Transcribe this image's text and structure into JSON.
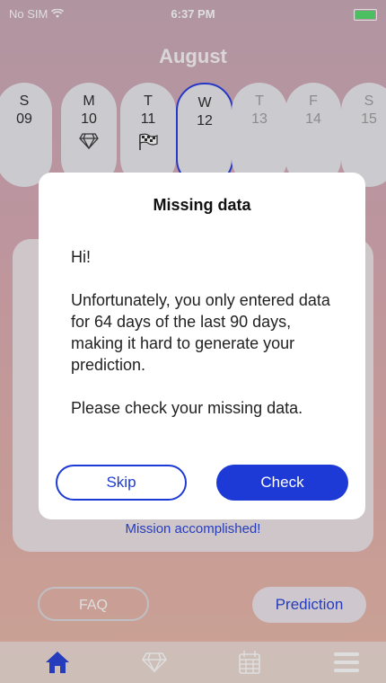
{
  "status": {
    "carrier": "No SIM",
    "time": "6:37 PM"
  },
  "calendar": {
    "month": "August",
    "days": [
      {
        "dow": "S",
        "num": "09",
        "icon": ""
      },
      {
        "dow": "M",
        "num": "10",
        "icon": "diamond-icon"
      },
      {
        "dow": "T",
        "num": "11",
        "icon": "checkered-flag-icon"
      },
      {
        "dow": "W",
        "num": "12",
        "icon": ""
      },
      {
        "dow": "T",
        "num": "13",
        "icon": ""
      },
      {
        "dow": "F",
        "num": "14",
        "icon": ""
      },
      {
        "dow": "S",
        "num": "15",
        "icon": ""
      }
    ],
    "selected_index": 3
  },
  "panel": {
    "mission_text": "Mission accomplished!"
  },
  "buttons": {
    "faq": "FAQ",
    "prediction": "Prediction"
  },
  "tabbar": {
    "icons": [
      "home-icon",
      "diamond-icon",
      "calendar-icon",
      "menu-icon"
    ],
    "active": "home-icon"
  },
  "modal": {
    "title": "Missing data",
    "greeting": "Hi!",
    "message": "Unfortunately, you only entered data for 64 days of the last 90 days, making it hard to generate your prediction.",
    "prompt": "Please check your missing data.",
    "skip_label": "Skip",
    "check_label": "Check"
  },
  "colors": {
    "accent": "#1d3ad6",
    "battery": "#4cd964"
  }
}
